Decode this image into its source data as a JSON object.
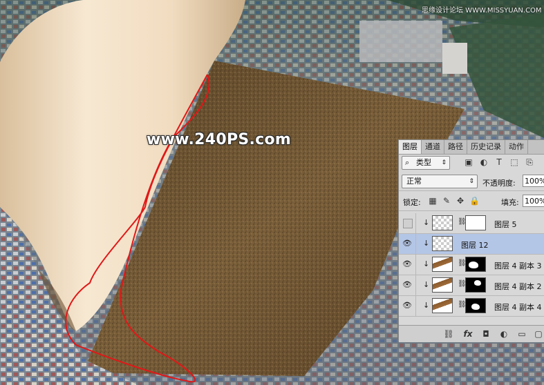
{
  "watermark": {
    "text": "www.240PS.com"
  },
  "site_mark": {
    "text": "思缘设计论坛 WWW.MISSYUAN.COM"
  },
  "layers_panel": {
    "tabs": [
      {
        "label": "图层",
        "active": true
      },
      {
        "label": "通道",
        "active": false
      },
      {
        "label": "路径",
        "active": false
      },
      {
        "label": "历史记录",
        "active": false
      },
      {
        "label": "动作",
        "active": false
      }
    ],
    "filter_kind": "类型",
    "blend_mode": "正常",
    "opacity_label": "不透明度:",
    "opacity_value": "100%",
    "lock_label": "锁定:",
    "fill_label": "填充:",
    "fill_value": "100%",
    "layers": [
      {
        "name": "图层 5",
        "visible": false,
        "selected": false,
        "thumb": "transparent",
        "mask": "white"
      },
      {
        "name": "图层 12",
        "visible": true,
        "selected": true,
        "thumb": "transparent",
        "mask": "none"
      },
      {
        "name": "图层 4 副本 3",
        "visible": true,
        "selected": false,
        "thumb": "plank",
        "mask": "black"
      },
      {
        "name": "图层 4 副本 2",
        "visible": true,
        "selected": false,
        "thumb": "plank",
        "mask": "black"
      },
      {
        "name": "图层 4 副本 4",
        "visible": true,
        "selected": false,
        "thumb": "plank",
        "mask": "black"
      }
    ]
  }
}
